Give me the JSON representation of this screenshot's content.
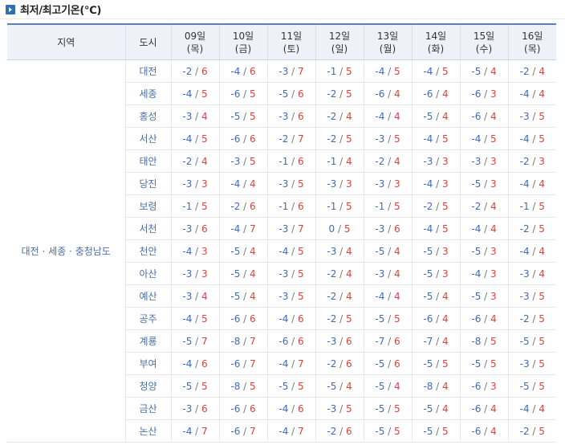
{
  "title": "최저/최고기온(℃)",
  "headers": {
    "region": "지역",
    "city": "도시",
    "days": [
      {
        "date": "09일",
        "weekday": "(목)"
      },
      {
        "date": "10일",
        "weekday": "(금)"
      },
      {
        "date": "11일",
        "weekday": "(토)"
      },
      {
        "date": "12일",
        "weekday": "(일)"
      },
      {
        "date": "13일",
        "weekday": "(월)"
      },
      {
        "date": "14일",
        "weekday": "(화)"
      },
      {
        "date": "15일",
        "weekday": "(수)"
      },
      {
        "date": "16일",
        "weekday": "(목)"
      }
    ]
  },
  "region_name": "대전 · 세종 · 충청남도",
  "rows": [
    {
      "city": "대전",
      "temps": [
        [
          "-2",
          "6"
        ],
        [
          "-4",
          "6"
        ],
        [
          "-3",
          "7"
        ],
        [
          "-1",
          "5"
        ],
        [
          "-4",
          "5"
        ],
        [
          "-4",
          "5"
        ],
        [
          "-5",
          "4"
        ],
        [
          "-2",
          "4"
        ]
      ]
    },
    {
      "city": "세종",
      "temps": [
        [
          "-4",
          "5"
        ],
        [
          "-6",
          "5"
        ],
        [
          "-5",
          "6"
        ],
        [
          "-2",
          "5"
        ],
        [
          "-6",
          "4"
        ],
        [
          "-6",
          "4"
        ],
        [
          "-6",
          "3"
        ],
        [
          "-4",
          "4"
        ]
      ]
    },
    {
      "city": "홍성",
      "temps": [
        [
          "-3",
          "4"
        ],
        [
          "-5",
          "5"
        ],
        [
          "-3",
          "6"
        ],
        [
          "-2",
          "4"
        ],
        [
          "-4",
          "4"
        ],
        [
          "-5",
          "4"
        ],
        [
          "-6",
          "4"
        ],
        [
          "-3",
          "5"
        ]
      ]
    },
    {
      "city": "서산",
      "temps": [
        [
          "-4",
          "5"
        ],
        [
          "-6",
          "6"
        ],
        [
          "-2",
          "7"
        ],
        [
          "-2",
          "5"
        ],
        [
          "-3",
          "5"
        ],
        [
          "-4",
          "5"
        ],
        [
          "-4",
          "5"
        ],
        [
          "-4",
          "5"
        ]
      ]
    },
    {
      "city": "태안",
      "temps": [
        [
          "-2",
          "4"
        ],
        [
          "-3",
          "5"
        ],
        [
          "-1",
          "6"
        ],
        [
          "-1",
          "4"
        ],
        [
          "-2",
          "4"
        ],
        [
          "-3",
          "3"
        ],
        [
          "-3",
          "3"
        ],
        [
          "-2",
          "3"
        ]
      ]
    },
    {
      "city": "당진",
      "temps": [
        [
          "-3",
          "3"
        ],
        [
          "-4",
          "4"
        ],
        [
          "-3",
          "5"
        ],
        [
          "-3",
          "3"
        ],
        [
          "-3",
          "3"
        ],
        [
          "-4",
          "3"
        ],
        [
          "-5",
          "3"
        ],
        [
          "-4",
          "4"
        ]
      ]
    },
    {
      "city": "보령",
      "temps": [
        [
          "-1",
          "5"
        ],
        [
          "-2",
          "6"
        ],
        [
          "-1",
          "6"
        ],
        [
          "-1",
          "5"
        ],
        [
          "-1",
          "5"
        ],
        [
          "-2",
          "5"
        ],
        [
          "-2",
          "4"
        ],
        [
          "-1",
          "5"
        ]
      ]
    },
    {
      "city": "서천",
      "temps": [
        [
          "-3",
          "6"
        ],
        [
          "-4",
          "7"
        ],
        [
          "-3",
          "7"
        ],
        [
          "0",
          "5"
        ],
        [
          "-3",
          "6"
        ],
        [
          "-4",
          "5"
        ],
        [
          "-4",
          "4"
        ],
        [
          "-2",
          "5"
        ]
      ]
    },
    {
      "city": "천안",
      "temps": [
        [
          "-4",
          "3"
        ],
        [
          "-5",
          "4"
        ],
        [
          "-4",
          "5"
        ],
        [
          "-3",
          "4"
        ],
        [
          "-5",
          "4"
        ],
        [
          "-5",
          "3"
        ],
        [
          "-5",
          "3"
        ],
        [
          "-4",
          "4"
        ]
      ]
    },
    {
      "city": "아산",
      "temps": [
        [
          "-3",
          "3"
        ],
        [
          "-5",
          "4"
        ],
        [
          "-3",
          "5"
        ],
        [
          "-2",
          "4"
        ],
        [
          "-3",
          "4"
        ],
        [
          "-5",
          "3"
        ],
        [
          "-4",
          "3"
        ],
        [
          "-3",
          "4"
        ]
      ]
    },
    {
      "city": "예산",
      "temps": [
        [
          "-3",
          "4"
        ],
        [
          "-5",
          "4"
        ],
        [
          "-3",
          "5"
        ],
        [
          "-2",
          "4"
        ],
        [
          "-4",
          "4"
        ],
        [
          "-5",
          "4"
        ],
        [
          "-5",
          "3"
        ],
        [
          "-3",
          "5"
        ]
      ]
    },
    {
      "city": "공주",
      "temps": [
        [
          "-4",
          "5"
        ],
        [
          "-6",
          "6"
        ],
        [
          "-4",
          "6"
        ],
        [
          "-2",
          "5"
        ],
        [
          "-5",
          "5"
        ],
        [
          "-6",
          "4"
        ],
        [
          "-6",
          "4"
        ],
        [
          "-2",
          "5"
        ]
      ]
    },
    {
      "city": "계룡",
      "temps": [
        [
          "-5",
          "7"
        ],
        [
          "-8",
          "7"
        ],
        [
          "-6",
          "6"
        ],
        [
          "-3",
          "6"
        ],
        [
          "-7",
          "6"
        ],
        [
          "-7",
          "4"
        ],
        [
          "-8",
          "5"
        ],
        [
          "-5",
          "5"
        ]
      ]
    },
    {
      "city": "부여",
      "temps": [
        [
          "-4",
          "6"
        ],
        [
          "-6",
          "7"
        ],
        [
          "-4",
          "7"
        ],
        [
          "-2",
          "6"
        ],
        [
          "-5",
          "6"
        ],
        [
          "-5",
          "5"
        ],
        [
          "-5",
          "5"
        ],
        [
          "-3",
          "5"
        ]
      ]
    },
    {
      "city": "청양",
      "temps": [
        [
          "-5",
          "5"
        ],
        [
          "-8",
          "5"
        ],
        [
          "-5",
          "5"
        ],
        [
          "-5",
          "4"
        ],
        [
          "-5",
          "4"
        ],
        [
          "-8",
          "4"
        ],
        [
          "-6",
          "3"
        ],
        [
          "-5",
          "5"
        ]
      ]
    },
    {
      "city": "금산",
      "temps": [
        [
          "-3",
          "6"
        ],
        [
          "-6",
          "6"
        ],
        [
          "-4",
          "6"
        ],
        [
          "-3",
          "5"
        ],
        [
          "-5",
          "5"
        ],
        [
          "-5",
          "4"
        ],
        [
          "-6",
          "4"
        ],
        [
          "-4",
          "4"
        ]
      ]
    },
    {
      "city": "논산",
      "temps": [
        [
          "-4",
          "7"
        ],
        [
          "-6",
          "7"
        ],
        [
          "-4",
          "7"
        ],
        [
          "-2",
          "6"
        ],
        [
          "-5",
          "5"
        ],
        [
          "-5",
          "5"
        ],
        [
          "-6",
          "4"
        ],
        [
          "-2",
          "5"
        ]
      ]
    }
  ]
}
